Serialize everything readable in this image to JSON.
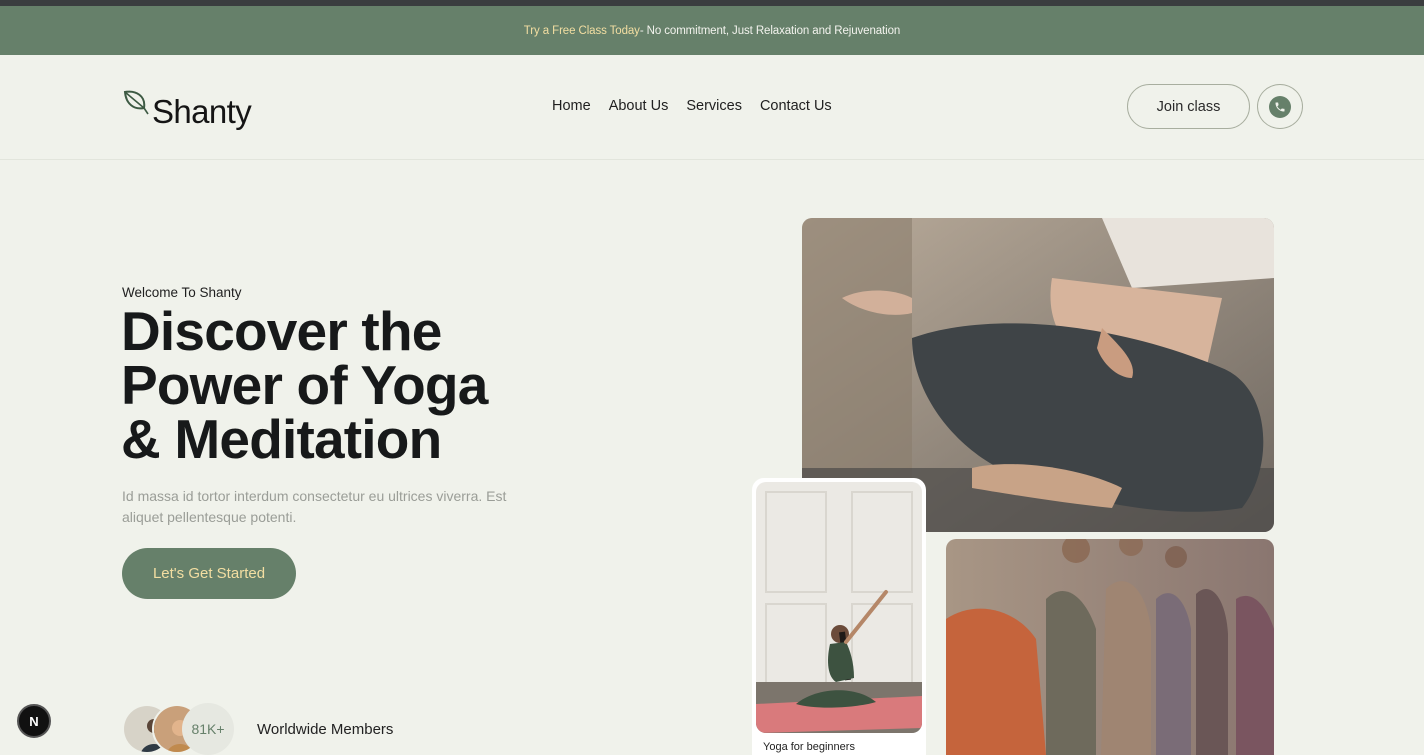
{
  "announcement": {
    "highlight": "Try a Free Class Today",
    "rest": " - No commitment, Just Relaxation and Rejuvenation"
  },
  "header": {
    "logo_text": "Shanty",
    "nav": [
      "Home",
      "About Us",
      "Services",
      "Contact Us"
    ],
    "join_label": "Join class",
    "phone_icon": "phone-icon"
  },
  "hero": {
    "welcome": "Welcome To Shanty",
    "headline": [
      "Discover the",
      "Power of Yoga",
      "& Meditation"
    ],
    "subtext": "Id massa id tortor interdum consectetur eu ultrices viverra. Est aliquet pellentesque potenti.",
    "cta_label": "Let's Get Started",
    "members_count": "81K+",
    "members_label": "Worldwide Members"
  },
  "gallery": {
    "small_caption": "Yoga for beginners"
  },
  "dev_badge": "N",
  "colors": {
    "accent": "#66806a",
    "accent_text": "#f3dea2",
    "background": "#f0f2eb"
  }
}
